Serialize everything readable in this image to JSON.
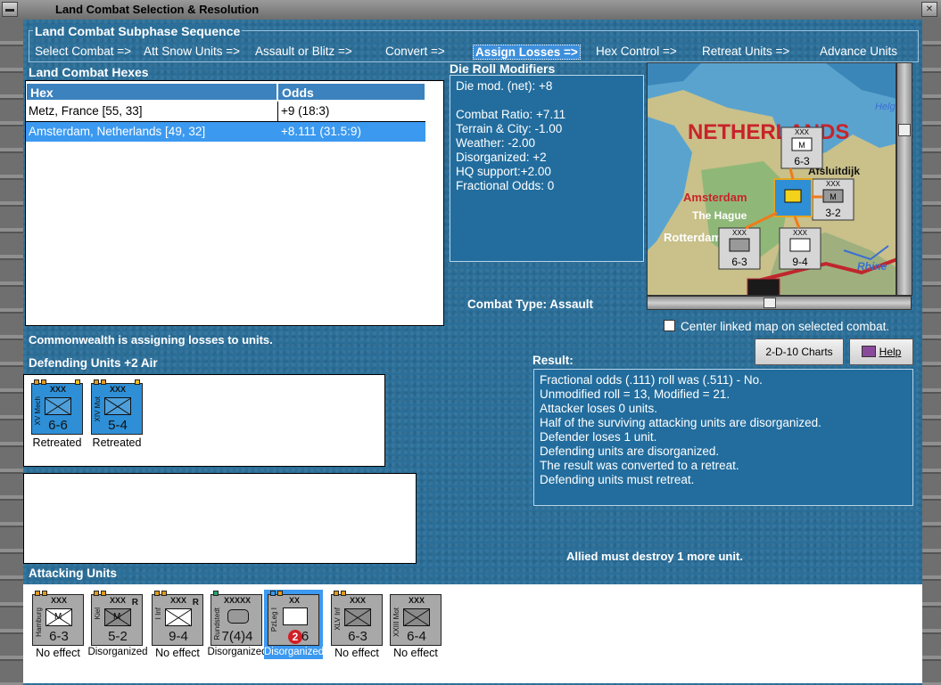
{
  "window": {
    "title": "Land Combat Selection & Resolution"
  },
  "subphase": {
    "legend": "Land Combat Subphase Sequence",
    "phases": [
      "Select Combat =>",
      "Att Snow Units =>",
      "Assault or Blitz =>",
      "Convert =>",
      "Assign Losses =>",
      "Hex Control =>",
      "Retreat Units =>",
      "Advance Units"
    ],
    "active_index": 4
  },
  "hexes": {
    "title": "Land Combat Hexes",
    "columns": [
      "Hex",
      "Odds"
    ],
    "rows": [
      {
        "hex": "Metz, France [55, 33]",
        "odds": "+9 (18:3)"
      },
      {
        "hex": "Amsterdam, Netherlands [49, 32]",
        "odds": "+8.111 (31.5:9)"
      }
    ],
    "selected_index": 1
  },
  "modifiers": {
    "title": "Die Roll Modifiers",
    "net": "Die mod. (net): +8",
    "lines": [
      "Combat Ratio: +7.11",
      "Terrain & City: -1.00",
      "Weather: -2.00",
      "Disorganized: +2",
      "HQ support:+2.00",
      "Fractional Odds: 0"
    ]
  },
  "combat_type": {
    "label": "Combat Type:",
    "value": "Assault"
  },
  "map": {
    "labels": [
      "NETHERLANDS",
      "Amsterdam",
      "The Hague",
      "Rotterdam",
      "Rhine",
      "Helg",
      "Afsluitdijk"
    ],
    "counters": [
      {
        "size": "XXX",
        "str": "6-3",
        "sym": "M"
      },
      {
        "size": "XXX",
        "str": "3-2",
        "sym": "M"
      },
      {
        "size": "XXX",
        "str": "6-3",
        "sym": ""
      },
      {
        "size": "XXX",
        "str": "9-4",
        "sym": ""
      }
    ],
    "checkbox_label": "Center linked map on selected combat."
  },
  "status_text": "Commonwealth is assigning losses to units.",
  "defending": {
    "title": "Defending Units +2 Air",
    "units": [
      {
        "size": "XXX",
        "name": "XV Mech",
        "str": "6-6",
        "status": "Retreated"
      },
      {
        "size": "XXX",
        "name": "XIV Mot",
        "str": "5-4",
        "status": "Retreated"
      }
    ]
  },
  "buttons": {
    "charts": "2-D-10 Charts",
    "help": "Help"
  },
  "result": {
    "title": "Result:",
    "lines": [
      "Fractional odds (.111) roll was (.511)  - No.",
      "Unmodified roll = 13, Modified = 21.",
      "Attacker loses 0 units.",
      "Half of the surviving attacking units are disorganized.",
      "Defender loses 1 unit.",
      "Defending units are disorganized.",
      "The result was converted to a retreat.",
      "Defending units must retreat."
    ]
  },
  "allied_message": "Allied must destroy 1 more unit.",
  "attacking": {
    "title": "Attacking Units",
    "units": [
      {
        "size": "XXX",
        "name": "Hamburg",
        "str": "6-3",
        "sym": "M",
        "r": "",
        "status": "No effect"
      },
      {
        "size": "XXX",
        "name": "Kiel",
        "str": "5-2",
        "sym": "M",
        "r": "R",
        "status": "Disorganized"
      },
      {
        "size": "XXX",
        "name": "I Inf",
        "str": "9-4",
        "sym": "",
        "r": "R",
        "status": "No effect"
      },
      {
        "size": "XXXXX",
        "name": "Rundstedt",
        "str": "7(4)4",
        "sym": "",
        "r": "",
        "status": "Disorganized"
      },
      {
        "size": "XX",
        "name": "PzLeg I",
        "str": "6",
        "badge": "2",
        "sym": "",
        "r": "",
        "status": "Disorganized"
      },
      {
        "size": "XXX",
        "name": "XLV Inf",
        "str": "6-3",
        "sym": "",
        "r": "",
        "status": "No effect"
      },
      {
        "size": "XXX",
        "name": "XXIII Mot",
        "str": "6-4",
        "sym": "",
        "r": "",
        "status": "No effect"
      }
    ],
    "selected_index": 4
  },
  "colors": {
    "background": "#2b6f99",
    "selected_row": "#3c99f0",
    "header": "#3b82be",
    "allied_counter": "#2e8fd6",
    "axis_counter": "#a8a8a8"
  }
}
